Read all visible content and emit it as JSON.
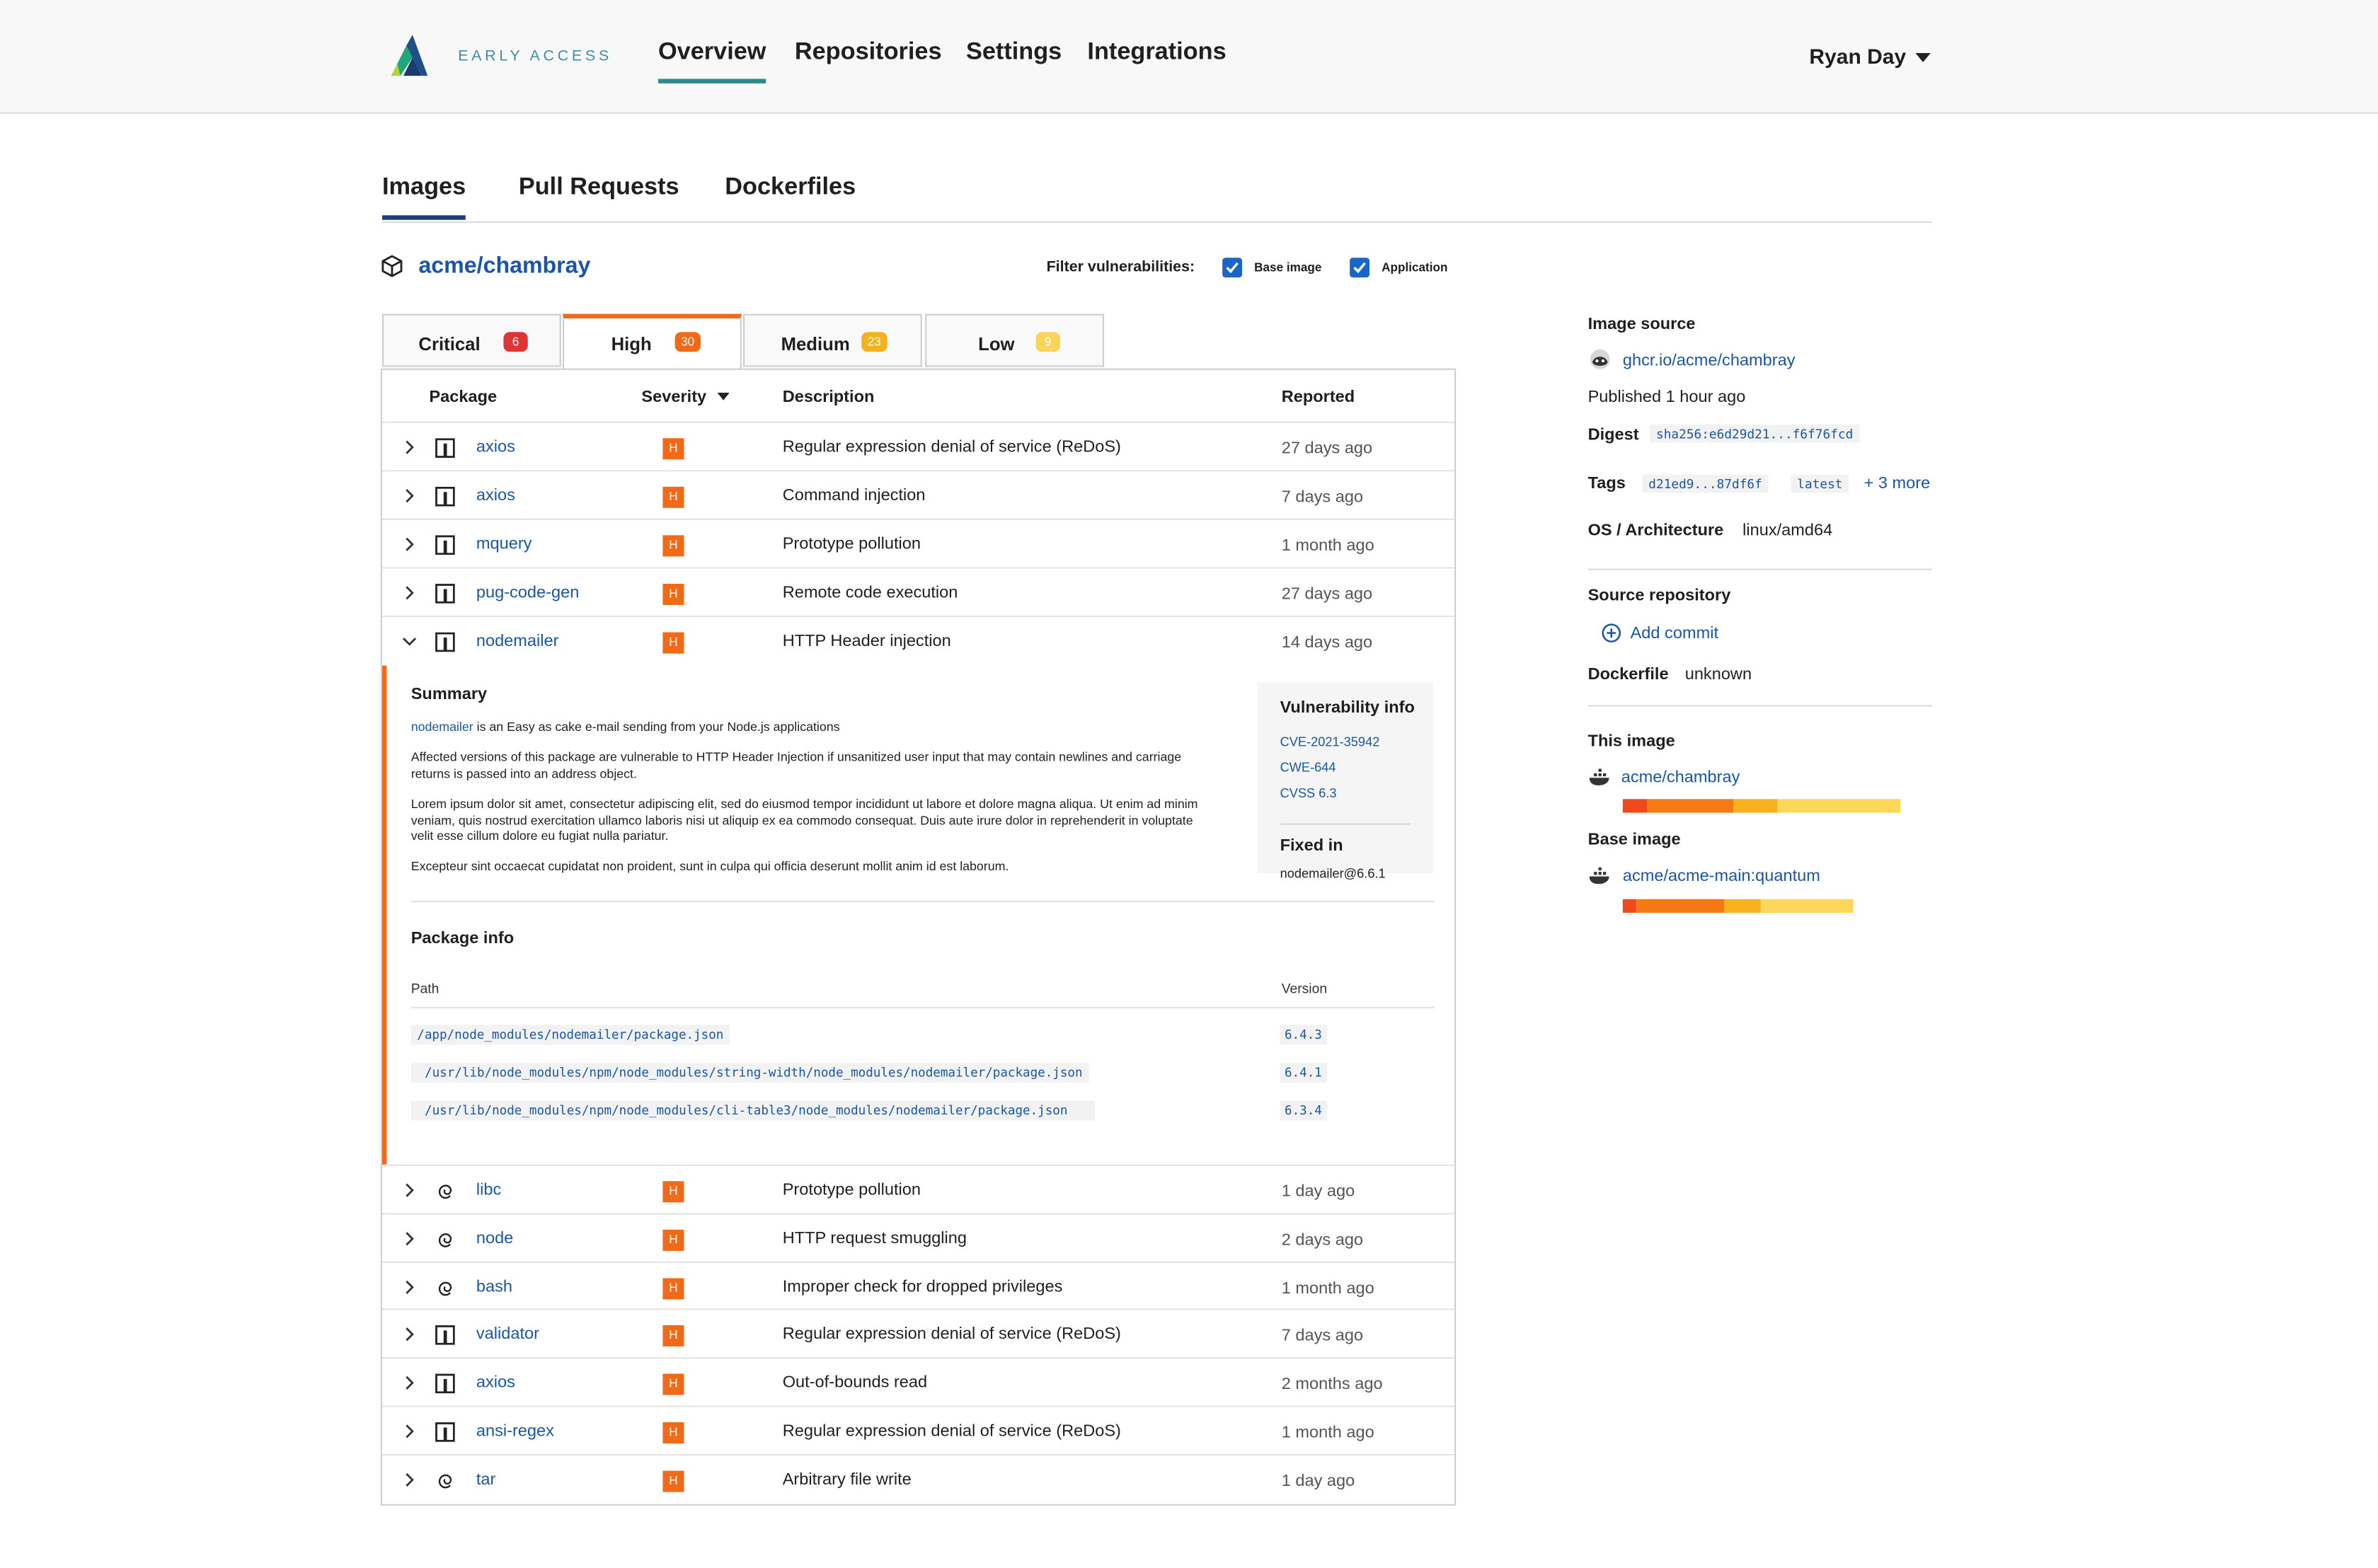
{
  "header": {
    "brand": "EARLY ACCESS",
    "nav": [
      "Overview",
      "Repositories",
      "Settings",
      "Integrations"
    ],
    "active_nav": "Overview",
    "user": "Ryan Day"
  },
  "subtabs": [
    "Images",
    "Pull Requests",
    "Dockerfiles"
  ],
  "image_name": "acme/chambray",
  "filter": {
    "label": "Filter vulnerabilities:",
    "options": [
      {
        "label": "Base image",
        "checked": true
      },
      {
        "label": "Application",
        "checked": true
      }
    ]
  },
  "severity_tabs": [
    {
      "label": "Critical",
      "count": "6",
      "color": "#e03535"
    },
    {
      "label": "High",
      "count": "30",
      "color": "#f06a1a"
    },
    {
      "label": "Medium",
      "count": "23",
      "color": "#f5b21f"
    },
    {
      "label": "Low",
      "count": "9",
      "color": "#f8d55a"
    }
  ],
  "table": {
    "headers": {
      "package": "Package",
      "severity": "Severity",
      "description": "Description",
      "reported": "Reported"
    },
    "rows_top": [
      {
        "package": "axios",
        "icon": "npm-package-icon",
        "severity": "H",
        "description": "Regular expression denial of service (ReDoS)",
        "reported": "27 days ago"
      },
      {
        "package": "axios",
        "icon": "npm-package-icon",
        "severity": "H",
        "description": "Command injection",
        "reported": "7 days ago"
      },
      {
        "package": "mquery",
        "icon": "npm-package-icon",
        "severity": "H",
        "description": "Prototype pollution",
        "reported": "1 month ago"
      },
      {
        "package": "pug-code-gen",
        "icon": "npm-package-icon",
        "severity": "H",
        "description": "Remote code execution",
        "reported": "27 days ago"
      }
    ],
    "expanded_row": {
      "package": "nodemailer",
      "icon": "npm-package-icon",
      "severity": "H",
      "description": "HTTP Header injection",
      "reported": "14 days ago"
    },
    "rows_bottom": [
      {
        "package": "libc",
        "icon": "debian-icon",
        "severity": "H",
        "description": "Prototype pollution",
        "reported": "1 day ago"
      },
      {
        "package": "node",
        "icon": "debian-icon",
        "severity": "H",
        "description": "HTTP request smuggling",
        "reported": "2 days ago"
      },
      {
        "package": "bash",
        "icon": "debian-icon",
        "severity": "H",
        "description": "Improper check for dropped privileges",
        "reported": "1 month ago"
      },
      {
        "package": "validator",
        "icon": "npm-package-icon",
        "severity": "H",
        "description": "Regular expression denial of service (ReDoS)",
        "reported": "7 days ago"
      },
      {
        "package": "axios",
        "icon": "npm-package-icon",
        "severity": "H",
        "description": "Out-of-bounds read",
        "reported": "2 months ago"
      },
      {
        "package": "ansi-regex",
        "icon": "npm-package-icon",
        "severity": "H",
        "description": "Regular expression denial of service (ReDoS)",
        "reported": "1 month ago"
      },
      {
        "package": "tar",
        "icon": "debian-icon",
        "severity": "H",
        "description": "Arbitrary file write",
        "reported": "1 day ago"
      }
    ]
  },
  "detail": {
    "summary_title": "Summary",
    "summary_link": "nodemailer",
    "summary_rest": " is an Easy as cake e-mail sending from your Node.js applications",
    "p1": "Affected versions of this package are vulnerable to HTTP Header Injection if unsanitized user input that may contain newlines and carriage returns is passed into an address object.",
    "p2": "Lorem ipsum dolor sit amet, consectetur adipiscing elit, sed do eiusmod tempor incididunt ut labore et dolore magna aliqua. Ut enim ad minim veniam, quis nostrud exercitation ullamco laboris nisi ut aliquip ex ea commodo consequat. Duis aute irure dolor in reprehenderit in voluptate velit esse cillum dolore eu fugiat nulla pariatur.",
    "p3": "Excepteur sint occaecat cupidatat non proident, sunt in culpa qui officia deserunt mollit anim id est laborum.",
    "vuln_info_title": "Vulnerability info",
    "vuln_links": [
      "CVE-2021-35942",
      "CWE-644",
      "CVSS 6.3"
    ],
    "fixed_in_title": "Fixed in",
    "fixed_in": "nodemailer@6.6.1",
    "package_info_title": "Package info",
    "path_header": "Path",
    "version_header": "Version",
    "paths": [
      {
        "path": "/app/node_modules/nodemailer/package.json",
        "version": "6.4.3"
      },
      {
        "path": "/usr/lib/node_modules/npm/node_modules/string-width/node_modules/nodemailer/package.json",
        "version": "6.4.1"
      },
      {
        "path": "/usr/lib/node_modules/npm/node_modules/cli-table3/node_modules/nodemailer/package.json",
        "version": "6.3.4"
      }
    ]
  },
  "sidebar": {
    "image_source_title": "Image source",
    "image_source": "ghcr.io/acme/chambray",
    "published": "Published 1 hour ago",
    "digest_label": "Digest",
    "digest": "sha256:e6d29d21...f6f76fcd",
    "tags_label": "Tags",
    "tags": [
      "d21ed9...87df6f",
      "latest"
    ],
    "tags_more": "+ 3 more",
    "os_label": "OS / Architecture",
    "os": "linux/amd64",
    "source_repo_title": "Source repository",
    "add_commit": "Add commit",
    "dockerfile_label": "Dockerfile",
    "dockerfile": "unknown",
    "this_image_title": "This image",
    "this_image": "acme/chambray",
    "this_image_bar": [
      {
        "severity": "critical",
        "fraction": 0.09,
        "color": "#f04a1a"
      },
      {
        "severity": "high",
        "fraction": 0.31,
        "color": "#f57a14"
      },
      {
        "severity": "medium",
        "fraction": 0.16,
        "color": "#f9b21e"
      },
      {
        "severity": "low",
        "fraction": 0.44,
        "color": "#fcd75a"
      }
    ],
    "base_image_title": "Base image",
    "base_image": "acme/acme-main:quantum",
    "base_image_bar": [
      {
        "severity": "critical",
        "fraction": 0.06,
        "color": "#f04a1a"
      },
      {
        "severity": "high",
        "fraction": 0.38,
        "color": "#f57a14"
      },
      {
        "severity": "medium",
        "fraction": 0.16,
        "color": "#f9b21e"
      },
      {
        "severity": "low",
        "fraction": 0.4,
        "color": "#fcd75a"
      }
    ]
  }
}
